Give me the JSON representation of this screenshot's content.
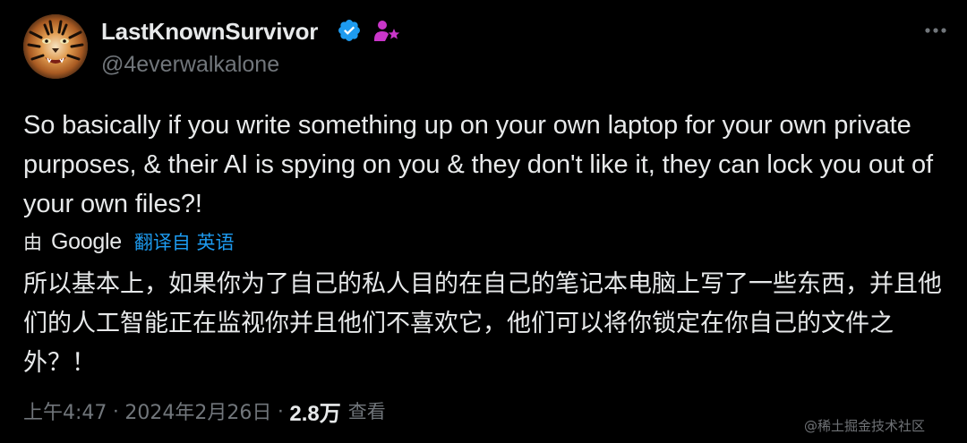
{
  "author": {
    "display_name": "LastKnownSurvivor",
    "handle": "@4everwalkalone",
    "avatar_icon": "tiger-avatar",
    "verified_icon": "verified-badge-icon",
    "affiliate_icon": "affiliate-badge-icon"
  },
  "menu": {
    "more_icon": "more-options-icon"
  },
  "tweet": {
    "text_en": "So basically if you write something up on your own laptop for your own private purposes, & their AI is spying on you & they don't like it, they can lock you out of your own files?!",
    "text_zh": "所以基本上，如果你为了自己的私人目的在自己的笔记本电脑上写了一些东西，并且他们的人工智能正在监视你并且他们不喜欢它，他们可以将你锁定在你自己的文件之外？！"
  },
  "translation": {
    "by_label": "由",
    "provider": "Google",
    "link_label": "翻译自 英语"
  },
  "meta": {
    "time": "上午4:47",
    "separator": "·",
    "date": "2024年2月26日",
    "views_count": "2.8万",
    "views_label": "查看"
  },
  "watermark": "@稀土掘金技术社区",
  "colors": {
    "background": "#000000",
    "text_primary": "#e7e9ea",
    "text_secondary": "#71767b",
    "link": "#1d9bf0",
    "verified": "#1d9bf0",
    "affiliate": "#c936c9"
  }
}
